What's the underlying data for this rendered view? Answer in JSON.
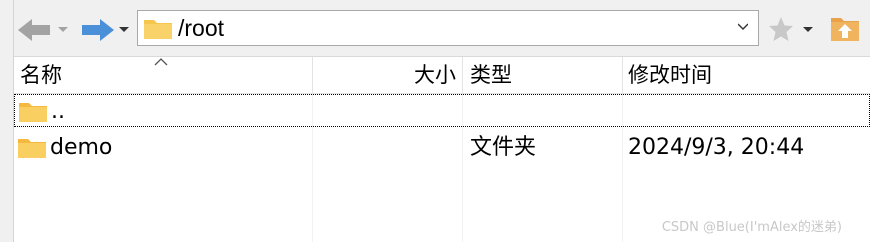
{
  "toolbar": {
    "back_icon": "back-arrow-icon",
    "forward_icon": "forward-arrow-icon",
    "path_value": "/root",
    "favorite_icon": "star-icon",
    "parent_dir_icon": "folder-up-icon"
  },
  "columns": {
    "name": "名称",
    "size": "大小",
    "type": "类型",
    "modified": "修改时间"
  },
  "rows": [
    {
      "name": "..",
      "size": "",
      "type": "",
      "modified": ""
    },
    {
      "name": "demo",
      "size": "",
      "type": "文件夹",
      "modified": "2024/9/3, 20:44"
    }
  ],
  "watermark": "CSDN @Blue(I'mAlex的迷弟)",
  "colors": {
    "folder": "#f7c74d",
    "forward_arrow": "#4a90d9",
    "back_arrow": "#9b9b9b",
    "up_folder": "#e8a24a"
  }
}
